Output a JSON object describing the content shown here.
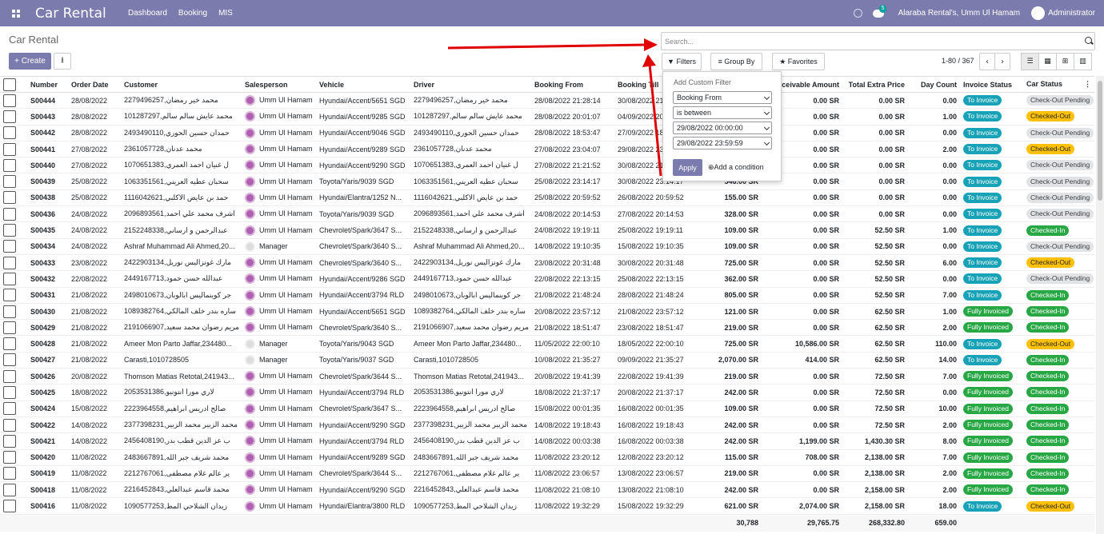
{
  "navbar": {
    "brand": "Car Rental",
    "menu": [
      "Dashboard",
      "Booking",
      "MIS"
    ],
    "chat_count": "5",
    "company": "Alaraba Rental's, Umm Ul Hamam",
    "user": "Administrator"
  },
  "control": {
    "title": "Car Rental",
    "create": "+ Create",
    "search_placeholder": "Search...",
    "filters": "Filters",
    "group_by": "Group By",
    "favorites": "Favorites",
    "pager": "1-80 / 367"
  },
  "filter_dropdown": {
    "title": "Add Custom Filter",
    "field": "Booking From",
    "operator": "is between",
    "date_from": "29/08/2022 00:00:00",
    "date_to": "29/08/2022 23:59:59",
    "apply": "Apply",
    "add_condition": "Add a condition"
  },
  "columns": [
    "Number",
    "Order Date",
    "Customer",
    "Salesperson",
    "Vehicle",
    "Driver",
    "Booking From",
    "Booking Till",
    "",
    "Receivable Amount",
    "Total Extra Price",
    "Day Count",
    "Invoice Status",
    "Car Status"
  ],
  "rows": [
    {
      "number": "S00444",
      "date": "28/08/2022",
      "customer": "2279496257,محمد خير رمضان",
      "sp": "Umm Ul Hamam",
      "vehicle": "Hyundai/Accent/5651 SGD",
      "driver": "2279496257,محمد خير رمضان",
      "from": "28/08/2022 21:28:14",
      "till": "30/08/2022 21:28:14",
      "amount": "",
      "recv": "0.00 SR",
      "extra": "0.00 SR",
      "days": "0.00",
      "inv": "To Invoice",
      "car": "Check-Out Pending"
    },
    {
      "number": "S00443",
      "date": "28/08/2022",
      "customer": "101287297,محمد عايش سالم سالم",
      "sp": "Umm Ul Hamam",
      "vehicle": "Hyundai/Accent/9285 SGD",
      "driver": "101287297,محمد عايش سالم سالم",
      "from": "28/08/2022 20:01:07",
      "till": "04/09/2022 20:01:07",
      "amount": "",
      "recv": "0.00 SR",
      "extra": "0.00 SR",
      "days": "1.00",
      "inv": "To Invoice",
      "car": "Checked-Out"
    },
    {
      "number": "S00442",
      "date": "28/08/2022",
      "customer": "2493490110,حمدان حسين الحوري",
      "sp": "Umm Ul Hamam",
      "vehicle": "Hyundai/Accent/9046 SGD",
      "driver": "2493490110,حمدان حسين الحوري",
      "from": "28/08/2022 18:53:47",
      "till": "27/09/2022 18:53:47",
      "amount": "",
      "recv": "0.00 SR",
      "extra": "0.00 SR",
      "days": "0.00",
      "inv": "To Invoice",
      "car": "Check-Out Pending"
    },
    {
      "number": "S00441",
      "date": "27/08/2022",
      "customer": "2361057728,محمد عدنان",
      "sp": "Umm Ul Hamam",
      "vehicle": "Hyundai/Accent/9289 SGD",
      "driver": "2361057728,محمد عدنان",
      "from": "27/08/2022 23:04:07",
      "till": "29/08/2022 23:04:07",
      "amount": "",
      "recv": "0.00 SR",
      "extra": "0.00 SR",
      "days": "2.00",
      "inv": "To Invoice",
      "car": "Checked-Out"
    },
    {
      "number": "S00440",
      "date": "27/08/2022",
      "customer": "1070651383,ل غنيان احمد العمري",
      "sp": "Umm Ul Hamam",
      "vehicle": "Hyundai/Accent/9290 SGD",
      "driver": "1070651383,ل غنيان احمد العمري",
      "from": "27/08/2022 21:21:52",
      "till": "30/08/2022 21:21:52",
      "amount": "",
      "recv": "0.00 SR",
      "extra": "0.00 SR",
      "days": "0.00",
      "inv": "To Invoice",
      "car": "Check-Out Pending"
    },
    {
      "number": "S00439",
      "date": "25/08/2022",
      "customer": "1063351561,سحبان عطيه العريني",
      "sp": "Umm Ul Hamam",
      "vehicle": "Toyota/Yaris/9039 SGD",
      "driver": "1063351561,سحبان عطيه العريني",
      "from": "25/08/2022 23:14:17",
      "till": "30/08/2022 23:14:17",
      "amount": "546.00 SR",
      "recv": "0.00 SR",
      "extra": "0.00 SR",
      "days": "0.00",
      "inv": "To Invoice",
      "car": "Check-Out Pending"
    },
    {
      "number": "S00438",
      "date": "25/08/2022",
      "customer": "1116042621,حمد بن عايض الاكلبي",
      "sp": "Umm Ul Hamam",
      "vehicle": "Hyundai/Elantra/1252 N...",
      "driver": "1116042621,حمد بن عايض الاكلبي",
      "from": "25/08/2022 20:59:52",
      "till": "26/08/2022 20:59:52",
      "amount": "155.00 SR",
      "recv": "0.00 SR",
      "extra": "0.00 SR",
      "days": "0.00",
      "inv": "To Invoice",
      "car": "Check-Out Pending"
    },
    {
      "number": "S00436",
      "date": "24/08/2022",
      "customer": "2096893561,اشرف محمد علي احمد",
      "sp": "Umm Ul Hamam",
      "vehicle": "Toyota/Yaris/9039 SGD",
      "driver": "2096893561,اشرف محمد علي احمد",
      "from": "24/08/2022 20:14:53",
      "till": "27/08/2022 20:14:53",
      "amount": "328.00 SR",
      "recv": "0.00 SR",
      "extra": "0.00 SR",
      "days": "0.00",
      "inv": "To Invoice",
      "car": "Check-Out Pending"
    },
    {
      "number": "S00435",
      "date": "24/08/2022",
      "customer": "2152248338,عبدالرحمن و ارساني",
      "sp": "Umm Ul Hamam",
      "vehicle": "Chevrolet/Spark/3647 S...",
      "driver": "2152248338,عبدالرحمن و ارساني",
      "from": "24/08/2022 19:19:11",
      "till": "25/08/2022 19:19:11",
      "amount": "109.00 SR",
      "recv": "0.00 SR",
      "extra": "52.50 SR",
      "days": "1.00",
      "inv": "To Invoice",
      "car": "Checked-In"
    },
    {
      "number": "S00434",
      "date": "24/08/2022",
      "customer": "Ashraf Muhammad Ali Ahmed,20...",
      "sp": "Manager",
      "vehicle": "Chevrolet/Spark/3640 S...",
      "driver": "Ashraf Muhammad Ali Ahmed,20...",
      "from": "14/08/2022 19:10:35",
      "till": "15/08/2022 19:10:35",
      "amount": "109.00 SR",
      "recv": "0.00 SR",
      "extra": "52.50 SR",
      "days": "0.00",
      "inv": "To Invoice",
      "car": "Check-Out Pending"
    },
    {
      "number": "S00433",
      "date": "23/08/2022",
      "customer": "2422903134,مارك غونزاليس نوريل",
      "sp": "Umm Ul Hamam",
      "vehicle": "Chevrolet/Spark/3640 S...",
      "driver": "2422903134,مارك غونزاليس نوريل",
      "from": "23/08/2022 20:31:48",
      "till": "30/08/2022 20:31:48",
      "amount": "725.00 SR",
      "recv": "0.00 SR",
      "extra": "52.50 SR",
      "days": "6.00",
      "inv": "To Invoice",
      "car": "Checked-Out"
    },
    {
      "number": "S00432",
      "date": "22/08/2022",
      "customer": "2449167713,عبدالله حسن حمود",
      "sp": "Umm Ul Hamam",
      "vehicle": "Hyundai/Accent/9286 SGD",
      "driver": "2449167713,عبدالله حسن حمود",
      "from": "22/08/2022 22:13:15",
      "till": "25/08/2022 22:13:15",
      "amount": "362.00 SR",
      "recv": "0.00 SR",
      "extra": "52.50 SR",
      "days": "0.00",
      "inv": "To Invoice",
      "car": "Check-Out Pending"
    },
    {
      "number": "S00431",
      "date": "21/08/2022",
      "customer": "2498010673,جر كوينماليس ابالوبان",
      "sp": "Umm Ul Hamam",
      "vehicle": "Hyundai/Accent/3794 RLD",
      "driver": "2498010673,جر كوينماليس ابالوبان",
      "from": "21/08/2022 21:48:24",
      "till": "28/08/2022 21:48:24",
      "amount": "805.00 SR",
      "recv": "0.00 SR",
      "extra": "52.50 SR",
      "days": "7.00",
      "inv": "To Invoice",
      "car": "Checked-In"
    },
    {
      "number": "S00430",
      "date": "21/08/2022",
      "customer": "1089382764,ساره بندر خلف المالكي",
      "sp": "Umm Ul Hamam",
      "vehicle": "Hyundai/Accent/5651 SGD",
      "driver": "1089382764,ساره بندر خلف المالكي",
      "from": "20/08/2022 23:57:12",
      "till": "21/08/2022 23:57:12",
      "amount": "121.00 SR",
      "recv": "0.00 SR",
      "extra": "62.50 SR",
      "days": "1.00",
      "inv": "Fully Invoiced",
      "car": "Checked-In"
    },
    {
      "number": "S00429",
      "date": "21/08/2022",
      "customer": "2191066907,مريم رضوان محمد سعيد",
      "sp": "Umm Ul Hamam",
      "vehicle": "Chevrolet/Spark/3640 S...",
      "driver": "2191066907,مريم رضوان محمد سعيد",
      "from": "21/08/2022 18:51:47",
      "till": "23/08/2022 18:51:47",
      "amount": "219.00 SR",
      "recv": "0.00 SR",
      "extra": "62.50 SR",
      "days": "2.00",
      "inv": "Fully Invoiced",
      "car": "Checked-In"
    },
    {
      "number": "S00428",
      "date": "21/08/2022",
      "customer": "Ameer Mon Parto Jaffar,234480...",
      "sp": "Manager",
      "vehicle": "Toyota/Yaris/9043 SGD",
      "driver": "Ameer Mon Parto Jaffar,234480...",
      "from": "11/05/2022 22:00:10",
      "till": "18/05/2022 22:00:10",
      "amount": "725.00 SR",
      "recv": "10,586.00 SR",
      "extra": "62.50 SR",
      "days": "110.00",
      "inv": "To Invoice",
      "car": "Checked-Out"
    },
    {
      "number": "S00427",
      "date": "21/08/2022",
      "customer": "Carasti,1010728505",
      "sp": "Manager",
      "vehicle": "Toyota/Yaris/9037 SGD",
      "driver": "Carasti,1010728505",
      "from": "10/08/2022 21:35:27",
      "till": "09/09/2022 21:35:27",
      "amount": "2,070.00 SR",
      "recv": "414.00 SR",
      "extra": "62.50 SR",
      "days": "14.00",
      "inv": "To Invoice",
      "car": "Checked-In"
    },
    {
      "number": "S00426",
      "date": "20/08/2022",
      "customer": "Thomson Matias Retotal,241943...",
      "sp": "Umm Ul Hamam",
      "vehicle": "Chevrolet/Spark/3644 S...",
      "driver": "Thomson Matias Retotal,241943...",
      "from": "20/08/2022 19:41:39",
      "till": "22/08/2022 19:41:39",
      "amount": "219.00 SR",
      "recv": "0.00 SR",
      "extra": "72.50 SR",
      "days": "7.00",
      "inv": "Fully Invoiced",
      "car": "Checked-In"
    },
    {
      "number": "S00425",
      "date": "18/08/2022",
      "customer": "2053531386,لاري مورا انتونيو",
      "sp": "Umm Ul Hamam",
      "vehicle": "Hyundai/Accent/3794 RLD",
      "driver": "2053531386,لاري مورا انتونيو",
      "from": "18/08/2022 21:37:17",
      "till": "20/08/2022 21:37:17",
      "amount": "242.00 SR",
      "recv": "0.00 SR",
      "extra": "72.50 SR",
      "days": "0.00",
      "inv": "Fully Invoiced",
      "car": "Checked-In"
    },
    {
      "number": "S00424",
      "date": "15/08/2022",
      "customer": "2223964558,صالح ادريس ابراهيم",
      "sp": "Umm Ul Hamam",
      "vehicle": "Chevrolet/Spark/3647 S...",
      "driver": "2223964558,صالح ادريس ابراهيم",
      "from": "15/08/2022 00:01:35",
      "till": "16/08/2022 00:01:35",
      "amount": "109.00 SR",
      "recv": "0.00 SR",
      "extra": "72.50 SR",
      "days": "10.00",
      "inv": "Fully Invoiced",
      "car": "Checked-In"
    },
    {
      "number": "S00422",
      "date": "14/08/2022",
      "customer": "2377398231,محمد الزبير محمد الزبير",
      "sp": "Umm Ul Hamam",
      "vehicle": "Hyundai/Accent/9290 SGD",
      "driver": "2377398231,محمد الزبير محمد الزبير",
      "from": "14/08/2022 19:18:43",
      "till": "16/08/2022 19:18:43",
      "amount": "242.00 SR",
      "recv": "0.00 SR",
      "extra": "72.50 SR",
      "days": "2.00",
      "inv": "Fully Invoiced",
      "car": "Checked-In"
    },
    {
      "number": "S00421",
      "date": "14/08/2022",
      "customer": "2456408190,ب عز الدين قطب بدر",
      "sp": "Umm Ul Hamam",
      "vehicle": "Hyundai/Accent/3794 RLD",
      "driver": "2456408190,ب عز الدين قطب بدر",
      "from": "14/08/2022 00:03:38",
      "till": "16/08/2022 00:03:38",
      "amount": "242.00 SR",
      "recv": "1,199.00 SR",
      "extra": "1,430.30 SR",
      "days": "8.00",
      "inv": "Fully Invoiced",
      "car": "Checked-In"
    },
    {
      "number": "S00420",
      "date": "11/08/2022",
      "customer": "2483667891,محمد شريف جبر الله",
      "sp": "Umm Ul Hamam",
      "vehicle": "Hyundai/Accent/9289 SGD",
      "driver": "2483667891,محمد شريف جبر الله",
      "from": "11/08/2022 23:20:12",
      "till": "12/08/2022 23:20:12",
      "amount": "115.00 SR",
      "recv": "708.00 SR",
      "extra": "2,138.00 SR",
      "days": "7.00",
      "inv": "Fully Invoiced",
      "car": "Checked-In"
    },
    {
      "number": "S00419",
      "date": "11/08/2022",
      "customer": "2212767061,ير عالم غلام مصطفى",
      "sp": "Umm Ul Hamam",
      "vehicle": "Chevrolet/Spark/3644 S...",
      "driver": "2212767061,ير عالم غلام مصطفى",
      "from": "11/08/2022 23:06:57",
      "till": "13/08/2022 23:06:57",
      "amount": "219.00 SR",
      "recv": "0.00 SR",
      "extra": "2,138.00 SR",
      "days": "2.00",
      "inv": "Fully Invoiced",
      "car": "Checked-In"
    },
    {
      "number": "S00418",
      "date": "11/08/2022",
      "customer": "2216452843,محمد قاسم عبدالعلي",
      "sp": "Umm Ul Hamam",
      "vehicle": "Hyundai/Accent/9290 SGD",
      "driver": "2216452843,محمد قاسم عبدالعلي",
      "from": "11/08/2022 21:08:10",
      "till": "13/08/2022 21:08:10",
      "amount": "242.00 SR",
      "recv": "0.00 SR",
      "extra": "2,158.00 SR",
      "days": "2.00",
      "inv": "Fully Invoiced",
      "car": "Checked-In"
    },
    {
      "number": "S00416",
      "date": "11/08/2022",
      "customer": "1090577253,زيدان الشلاحي المط",
      "sp": "Umm Ul Hamam",
      "vehicle": "Hyundai/Elantra/3800 RLD",
      "driver": "1090577253,زيدان الشلاحي المط",
      "from": "11/08/2022 19:32:29",
      "till": "15/08/2022 19:32:29",
      "amount": "621.00 SR",
      "recv": "2,074.00 SR",
      "extra": "2,158.00 SR",
      "days": "18.00",
      "inv": "To Invoice",
      "car": "Checked-Out"
    }
  ],
  "totals": {
    "amount": "30,788",
    "recv": "29,765.75",
    "extra": "268,332.80",
    "days": "659.00"
  },
  "colors": {
    "navbar": "#7c7bad",
    "annotation_arrow": "#e00000"
  }
}
